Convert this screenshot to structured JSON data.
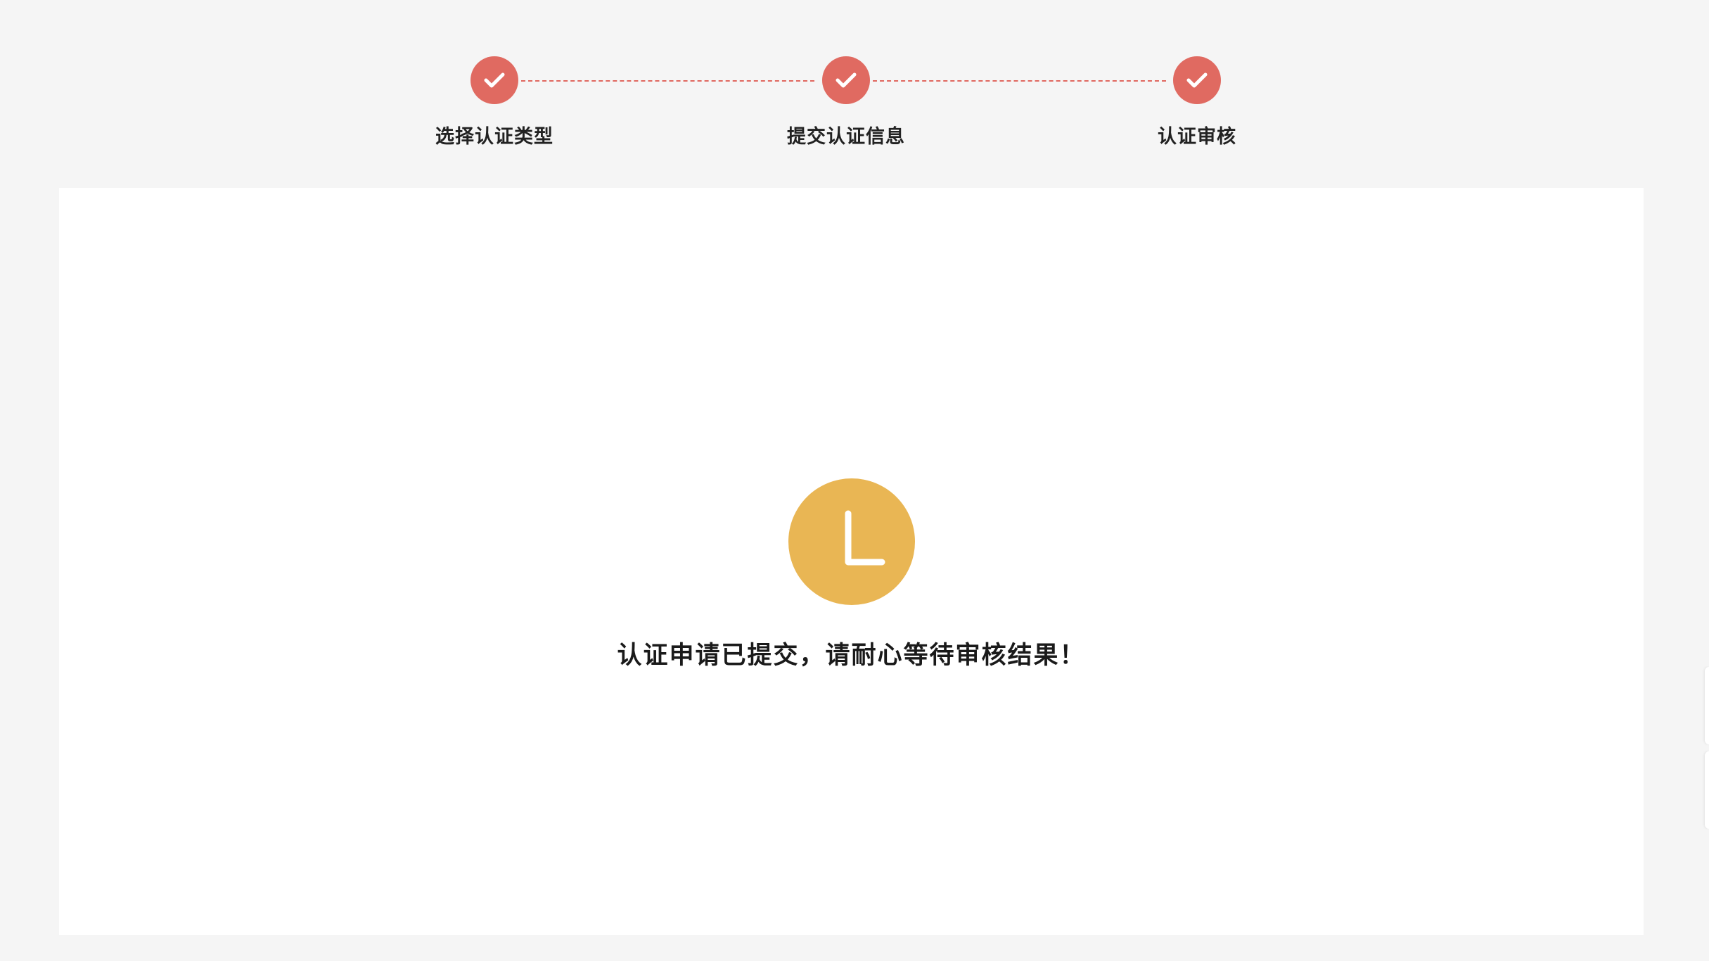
{
  "steps": {
    "items": [
      {
        "label": "选择认证类型",
        "icon": "check-icon"
      },
      {
        "label": "提交认证信息",
        "icon": "check-icon"
      },
      {
        "label": "认证审核",
        "icon": "check-icon"
      }
    ]
  },
  "status": {
    "icon": "clock-icon",
    "message": "认证申请已提交，请耐心等待审核结果！"
  },
  "colors": {
    "step_complete": "#e06a61",
    "status_pending": "#e9b654",
    "background": "#f5f5f5"
  }
}
